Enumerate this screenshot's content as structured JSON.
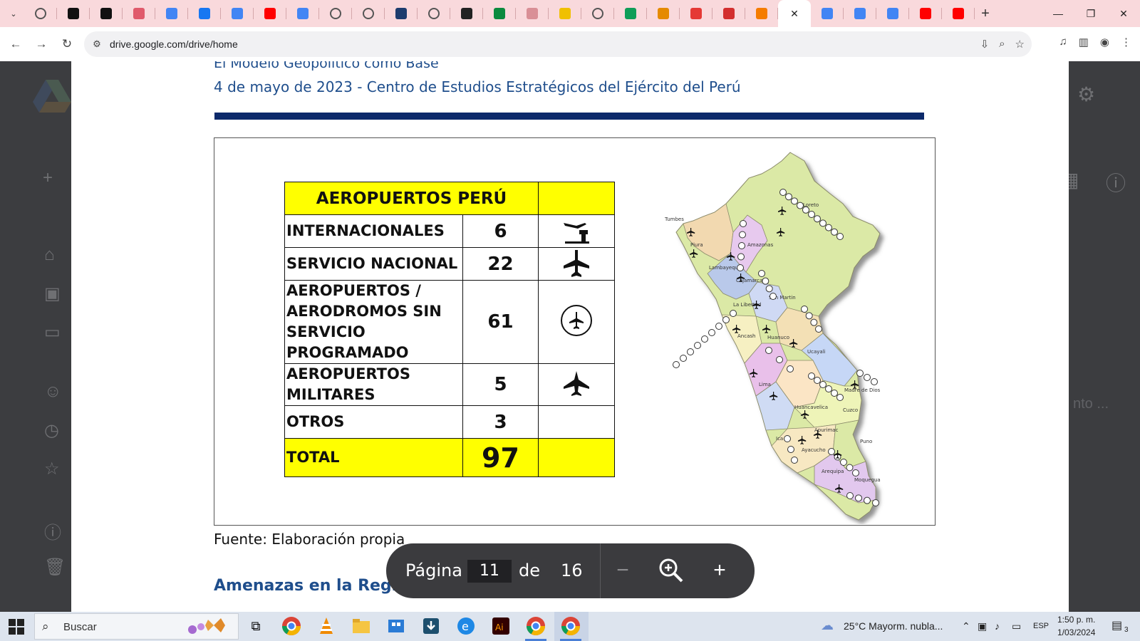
{
  "browser": {
    "tabs": [
      {
        "icon": "globe-icon",
        "color": "#555555"
      },
      {
        "icon": "z-app-icon",
        "color": "#111111"
      },
      {
        "icon": "z-app-icon",
        "color": "#111111"
      },
      {
        "icon": "target-icon",
        "color": "#e05a6b"
      },
      {
        "icon": "doc-icon",
        "color": "#4285f4"
      },
      {
        "icon": "facebook-icon",
        "color": "#1877f2"
      },
      {
        "icon": "forms-icon",
        "color": "#4285f4"
      },
      {
        "icon": "youtube-icon",
        "color": "#ff0000"
      },
      {
        "icon": "google-icon",
        "color": "#4285f4"
      },
      {
        "icon": "globe-icon",
        "color": "#555555"
      },
      {
        "icon": "globe-icon",
        "color": "#555555"
      },
      {
        "icon": "h-app-icon",
        "color": "#1d3c6e"
      },
      {
        "icon": "globe-icon",
        "color": "#555555"
      },
      {
        "icon": "news-icon",
        "color": "#222222"
      },
      {
        "icon": "dc-icon",
        "color": "#0b8a3e"
      },
      {
        "icon": "pattern-icon",
        "color": "#d98f96"
      },
      {
        "icon": "app-yellow-icon",
        "color": "#f0c000"
      },
      {
        "icon": "globe-icon",
        "color": "#555555"
      },
      {
        "icon": "drive-icon",
        "color": "#0f9d58"
      },
      {
        "icon": "h-orange-icon",
        "color": "#e58a00"
      },
      {
        "icon": "bolt-icon",
        "color": "#e53935"
      },
      {
        "icon": "acrobat-icon",
        "color": "#d32f2f"
      },
      {
        "icon": "blogger-icon",
        "color": "#f57c00"
      }
    ],
    "active_tab_close": "✕",
    "right_tabs": [
      {
        "icon": "doc-icon",
        "color": "#4285f4"
      },
      {
        "icon": "doc-icon",
        "color": "#4285f4"
      },
      {
        "icon": "doc-icon",
        "color": "#4285f4"
      },
      {
        "icon": "youtube-icon",
        "color": "#ff0000"
      },
      {
        "icon": "youtube-icon",
        "color": "#ff0000"
      }
    ],
    "new_tab": "+",
    "url": "drive.google.com/drive/home"
  },
  "document": {
    "cut_title": "El Modelo Geopolítico como Base",
    "subtitle": "4 de mayo de 2023 - Centro de Estudios Estratégicos del Ejército del Perú",
    "rule_color": "#0d2a6b",
    "table": {
      "header": "AEROPUERTOS PERÚ",
      "rows": [
        {
          "category": "INTERNACIONALES",
          "value": "6",
          "icon": "control-tower-icon"
        },
        {
          "category": "SERVICIO NACIONAL",
          "value": "22",
          "icon": "airplane-icon"
        },
        {
          "category": "AEROPUERTOS / AERODROMOS SIN SERVICIO PROGRAMADO",
          "value": "61",
          "icon": "circled-airplane-icon"
        },
        {
          "category": "AEROPUERTOS MILITARES",
          "value": "5",
          "icon": "jet-icon"
        },
        {
          "category": "OTROS",
          "value": "3",
          "icon": ""
        }
      ],
      "total_label": "TOTAL",
      "total_value": "97",
      "highlight_color": "#ffff00",
      "total_color": "#c0161b"
    },
    "map_labels": [
      "Tumbes",
      "Piura",
      "Loreto",
      "Amazonas",
      "Lambayeque",
      "Cajamarca",
      "San Martin",
      "La Libertad",
      "Ancash",
      "Huanuco",
      "Ucayali",
      "Lima",
      "Madre de Dios",
      "Huancavelica",
      "Cuzco",
      "Apurimac",
      "Ica",
      "Ayacucho",
      "Puno",
      "Arequipa",
      "Moquegua"
    ],
    "caption": "Fuente: Elaboración propia",
    "section_heading": "Amenazas en la Región"
  },
  "viewer": {
    "page_label": "Página",
    "current_page": "11",
    "of_label": "de",
    "total_pages": "16",
    "zoom_out": "−",
    "zoom_in": "+"
  },
  "taskbar": {
    "search_placeholder": "Buscar",
    "weather": "25°C  Mayorm. nubla...",
    "language": "ESP",
    "time": "1:50 p. m.",
    "date": "1/03/2024",
    "notifications": "3"
  }
}
